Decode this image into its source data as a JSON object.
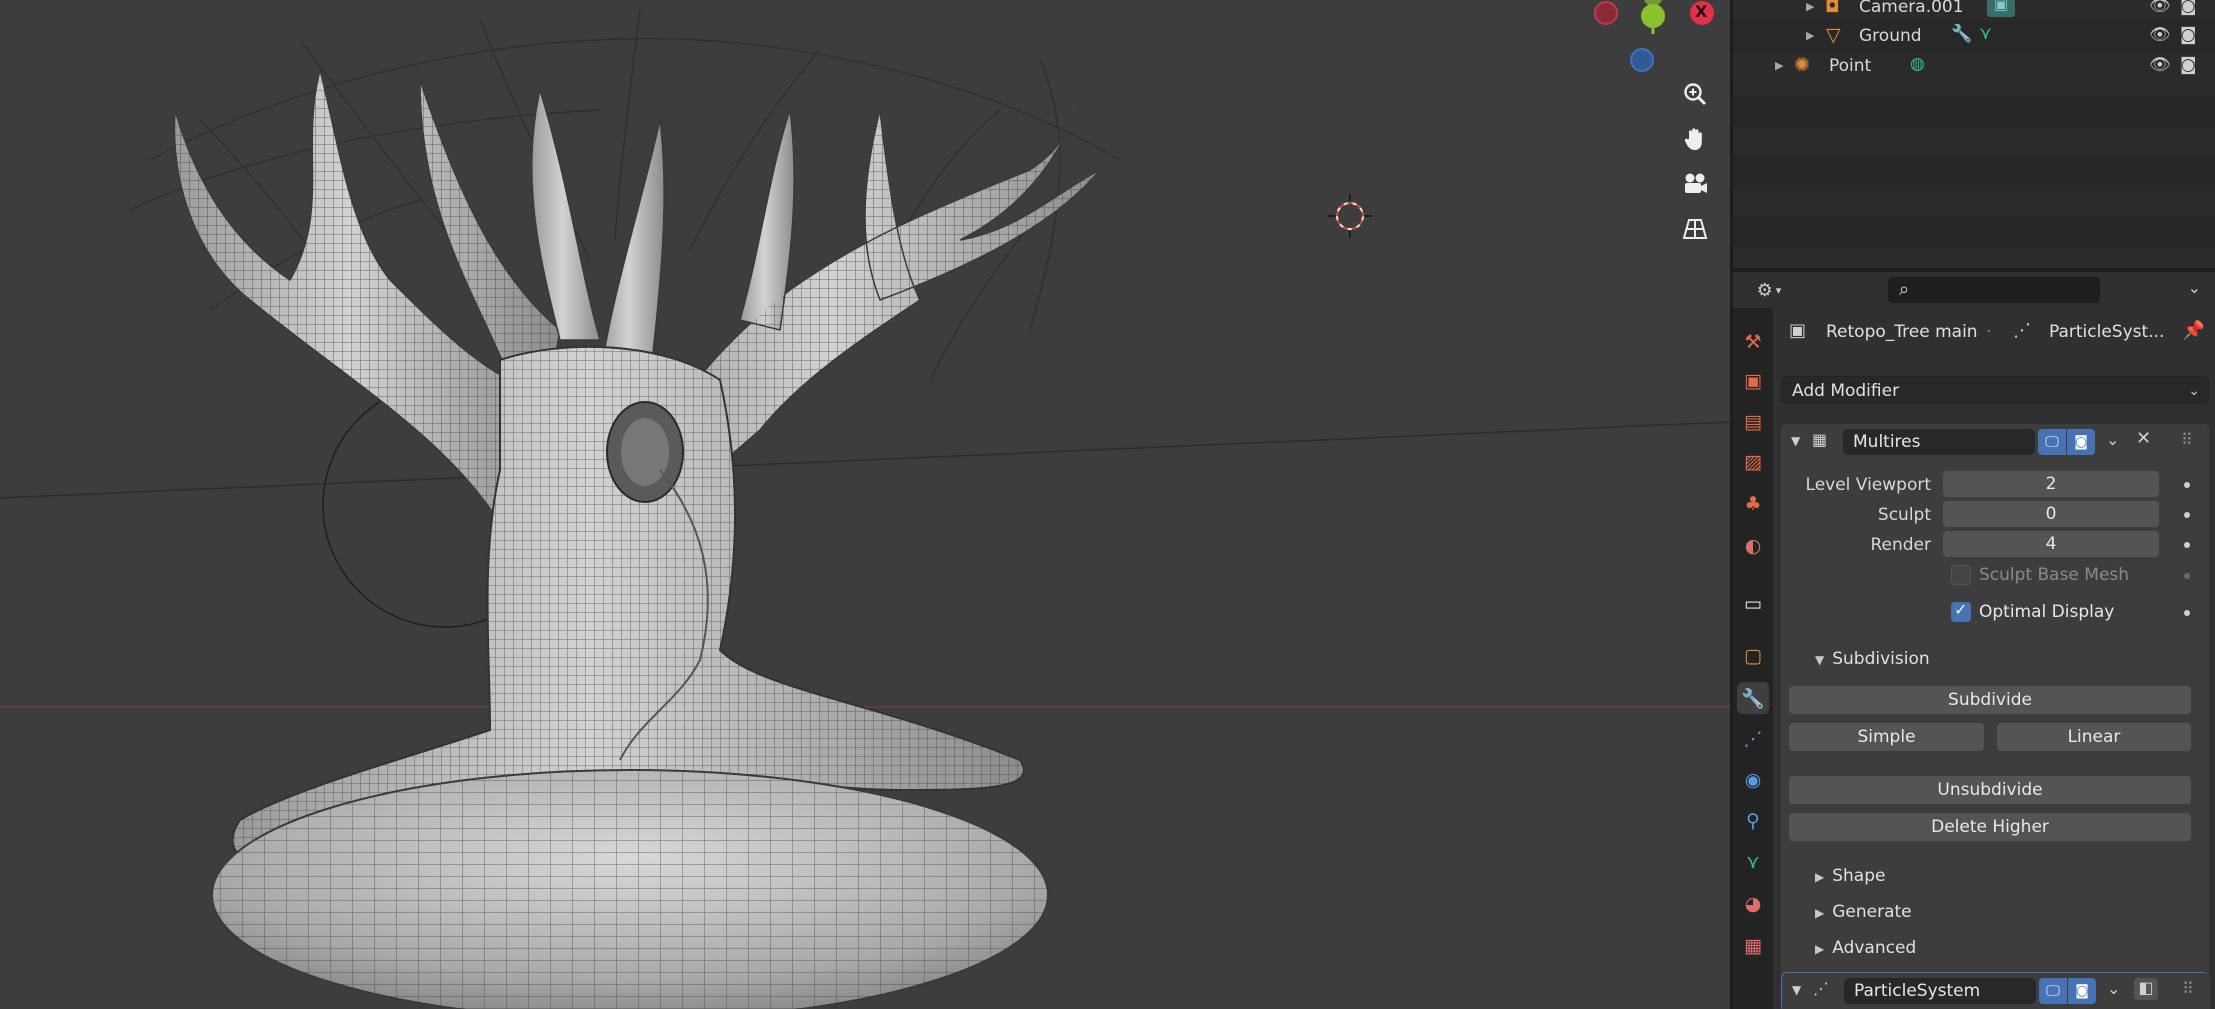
{
  "outliner": {
    "items": [
      {
        "label": "Camera.001",
        "icon": "camera-object-icon",
        "extra_icon": "camera-data-icon"
      },
      {
        "label": "Ground",
        "icon": "mesh-object-icon",
        "extra_icons": [
          "wrench-icon",
          "mesh-data-icon"
        ]
      },
      {
        "label": "Point",
        "icon": "light-object-icon",
        "extra_icon": "light-data-icon"
      }
    ]
  },
  "properties": {
    "context": {
      "object_name": "Retopo_Tree main",
      "modifier_name": "ParticleSyst..."
    },
    "add_modifier_label": "Add Modifier",
    "multires": {
      "name": "Multires",
      "level_viewport_label": "Level Viewport",
      "level_viewport_value": "2",
      "sculpt_label": "Sculpt",
      "sculpt_value": "0",
      "render_label": "Render",
      "render_value": "4",
      "sculpt_base_mesh_label": "Sculpt Base Mesh",
      "sculpt_base_mesh_checked": false,
      "optimal_display_label": "Optimal Display",
      "optimal_display_checked": true,
      "subdivision_label": "Subdivision",
      "subdivide_label": "Subdivide",
      "simple_label": "Simple",
      "linear_label": "Linear",
      "unsubdivide_label": "Unsubdivide",
      "delete_higher_label": "Delete Higher",
      "shape_label": "Shape",
      "generate_label": "Generate",
      "advanced_label": "Advanced"
    },
    "particle_system": {
      "name": "ParticleSystem"
    }
  },
  "gizmo": {
    "x_label": "X"
  },
  "colors": {
    "accent_blue": "#4772b3",
    "axis_x": "#e0324a",
    "axis_y": "#8ac130",
    "axis_z": "#3b73c4",
    "tab_wrench": "#5b9be0"
  }
}
